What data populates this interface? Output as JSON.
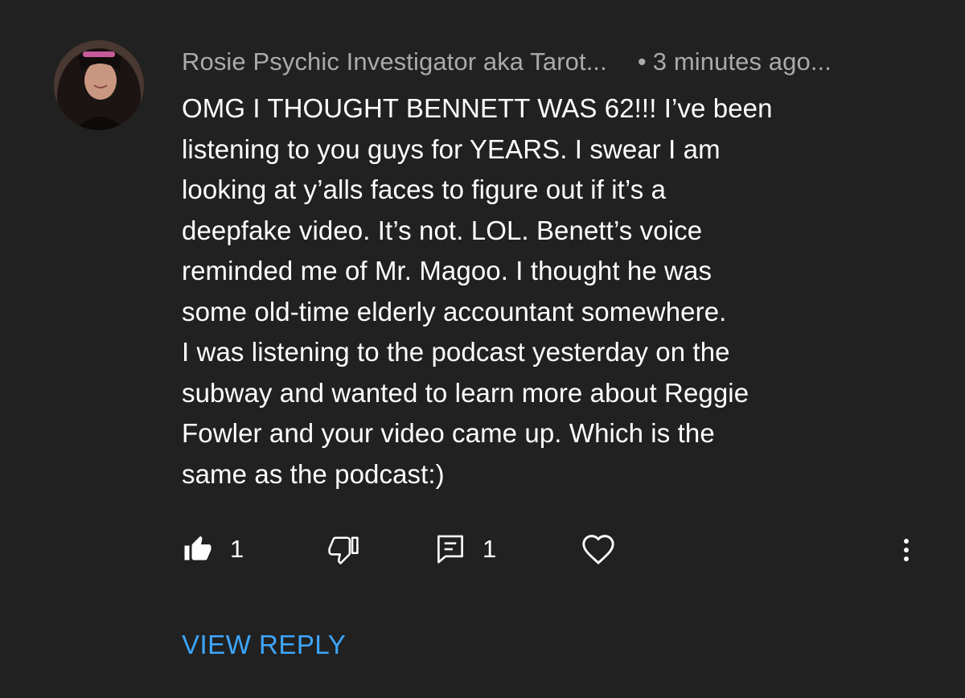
{
  "comment": {
    "author": "Rosie Psychic Investigator aka Tarot...",
    "separator": "•",
    "time": "3 minutes ago...",
    "text": "OMG I THOUGHT BENNETT WAS 62!!! I’ve been\nlistening to you guys for YEARS. I swear I am\nlooking at y’alls faces to figure out if it’s a\ndeepfake video. It’s not. LOL. Benett’s voice\nreminded me of Mr. Magoo. I thought he was\nsome old-time elderly accountant somewhere.\nI was listening to the podcast yesterday on the\nsubway and wanted to learn more about Reggie\nFowler and your video came up. Which is the\nsame as the podcast:)"
  },
  "actions": {
    "like_count": "1",
    "reply_count": "1",
    "like_icon": "thumbs-up-filled-icon",
    "dislike_icon": "thumbs-down-outline-icon",
    "reply_icon": "comment-reply-icon",
    "heart_icon": "heart-outline-icon",
    "more_icon": "vertical-ellipsis-icon"
  },
  "view_reply_label": "VIEW REPLY",
  "colors": {
    "background": "#212121",
    "meta_text": "#aaaaaa",
    "body_text": "#ffffff",
    "link": "#3ea6ff"
  }
}
